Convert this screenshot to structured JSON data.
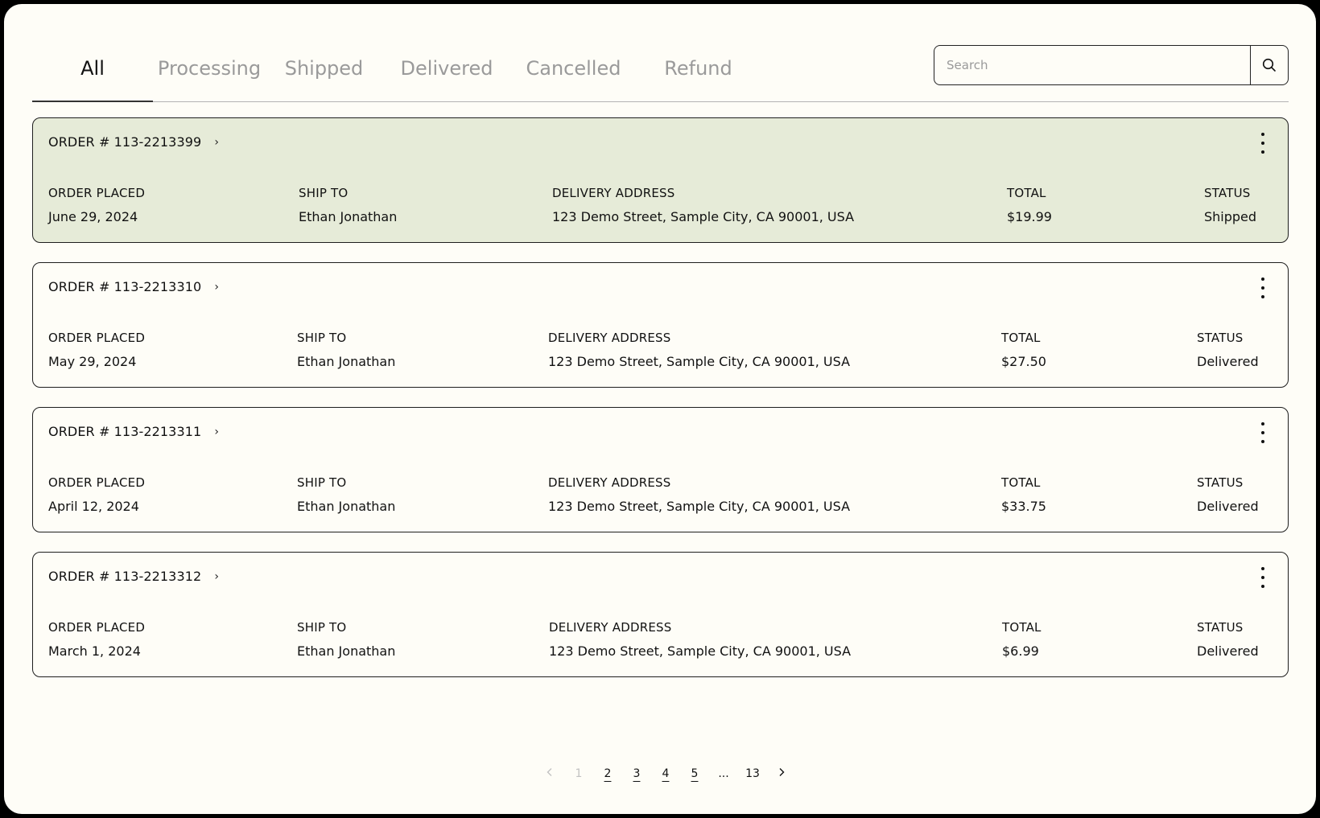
{
  "tabs": [
    {
      "label": "All",
      "active": true
    },
    {
      "label": "Processing",
      "active": false
    },
    {
      "label": "Shipped",
      "active": false
    },
    {
      "label": "Delivered",
      "active": false
    },
    {
      "label": "Cancelled",
      "active": false
    },
    {
      "label": "Refund",
      "active": false
    }
  ],
  "search": {
    "placeholder": "Search",
    "icon": "search-icon"
  },
  "labels": {
    "order_placed": "ORDER PLACED",
    "ship_to": "SHIP TO",
    "delivery_address": "DELIVERY ADDRESS",
    "total": "TOTAL",
    "status": "STATUS"
  },
  "orders": [
    {
      "number": "ORDER # 113-2213399",
      "placed": "June 29, 2024",
      "ship_to": "Ethan Jonathan",
      "address": "123 Demo Street, Sample City, CA 90001, USA",
      "total": "$19.99",
      "status": "Shipped",
      "highlighted": true
    },
    {
      "number": "ORDER # 113-2213310",
      "placed": "May 29, 2024",
      "ship_to": "Ethan Jonathan",
      "address": "123 Demo Street, Sample City, CA 90001, USA",
      "total": "$27.50",
      "status": "Delivered",
      "highlighted": false
    },
    {
      "number": "ORDER # 113-2213311",
      "placed": "April 12, 2024",
      "ship_to": "Ethan Jonathan",
      "address": "123 Demo Street, Sample City, CA 90001, USA",
      "total": "$33.75",
      "status": "Delivered",
      "highlighted": false
    },
    {
      "number": "ORDER # 113-2213312",
      "placed": "March 1, 2024",
      "ship_to": "Ethan Jonathan",
      "address": "123 Demo Street, Sample City, CA 90001, USA",
      "total": "$6.99",
      "status": "Delivered",
      "highlighted": false
    }
  ],
  "pagination": {
    "pages": [
      "1",
      "2",
      "3",
      "4",
      "5",
      "...",
      "13"
    ],
    "current": "1"
  },
  "colors": {
    "background": "#fefdf7",
    "highlight": "#e6ebd8",
    "inactive_tab": "#9a9a9a",
    "border": "#1e1e1e"
  }
}
